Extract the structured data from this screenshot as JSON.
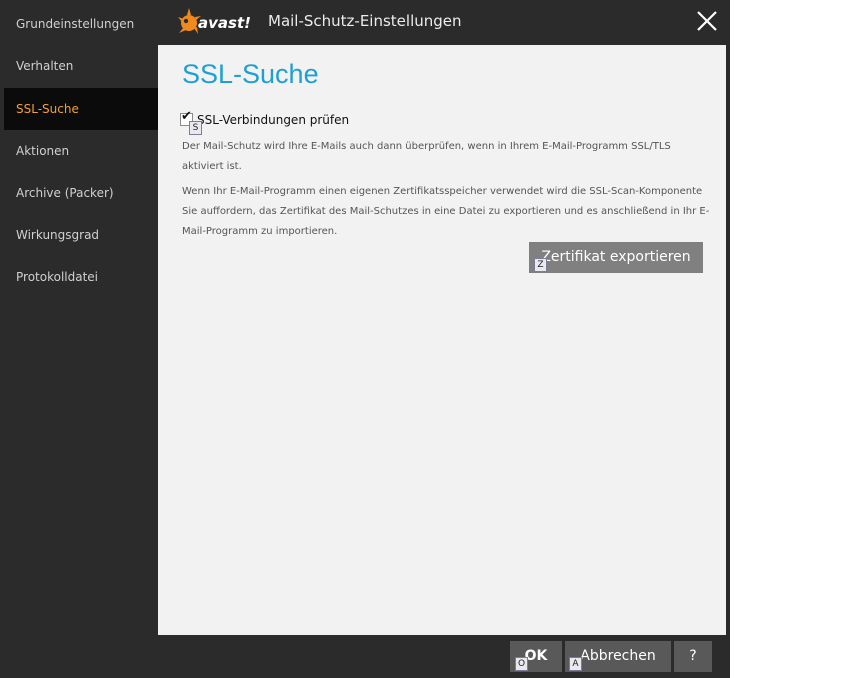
{
  "window": {
    "brand": "avast!",
    "title": "Mail-Schutz-Einstellungen"
  },
  "sidebar": {
    "items": [
      {
        "label": "Grundeinstellungen"
      },
      {
        "label": "Verhalten"
      },
      {
        "label": "SSL-Suche",
        "active": true
      },
      {
        "label": "Aktionen"
      },
      {
        "label": "Archive (Packer)"
      },
      {
        "label": "Wirkungsgrad"
      },
      {
        "label": "Protokolldatei"
      }
    ]
  },
  "main": {
    "title": "SSL-Suche",
    "checkbox": {
      "label": "SSL-Verbindungen prüfen",
      "checked": true,
      "hotkey": "S"
    },
    "description1": "Der Mail-Schutz wird Ihre E-Mails auch dann überprüfen, wenn in Ihrem E-Mail-Programm SSL/TLS aktiviert ist.",
    "description2": "Wenn Ihr E-Mail-Programm einen eigenen Zertifikatsspeicher verwendet wird die SSL-Scan-Komponente Sie auffordern, das Zertifikat des Mail-Schutzes in eine Datei zu exportieren und es anschließend in Ihr E-Mail-Programm zu importieren.",
    "export_button": {
      "label": "Zertifikat exportieren",
      "hotkey": "Z"
    }
  },
  "footer": {
    "ok": {
      "label": "OK",
      "hotkey": "O"
    },
    "cancel": {
      "label": "Abbrechen",
      "hotkey": "A"
    },
    "help": {
      "label": "?"
    }
  },
  "colors": {
    "accent_title": "#1f9fd2",
    "active_nav": "#f0a13a",
    "logo_orange": "#f08a1c"
  },
  "icons": {
    "close": "close-icon",
    "logo": "avast-logo-icon",
    "check": "checkmark-icon"
  }
}
